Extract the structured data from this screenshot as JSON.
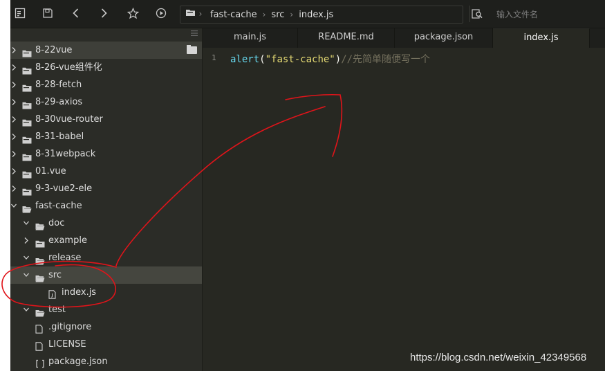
{
  "toolbar": {
    "icons": [
      "sidebar-toggle-icon",
      "save-icon",
      "back-icon",
      "forward-icon",
      "star-icon",
      "play-icon"
    ],
    "path": {
      "segments": [
        "fast-cache",
        "src",
        "index.js"
      ],
      "separator": "›"
    },
    "search": {
      "placeholder": "输入文件名"
    }
  },
  "sidebar": {
    "items": [
      {
        "label": "8-22vue",
        "type": "folder",
        "state": "collapsed"
      },
      {
        "label": "8-26-vue组件化",
        "type": "folder",
        "state": "collapsed"
      },
      {
        "label": "8-28-fetch",
        "type": "folder",
        "state": "collapsed"
      },
      {
        "label": "8-29-axios",
        "type": "folder",
        "state": "collapsed"
      },
      {
        "label": "8-30vue-router",
        "type": "folder",
        "state": "collapsed"
      },
      {
        "label": "8-31-babel",
        "type": "folder",
        "state": "collapsed"
      },
      {
        "label": "8-31webpack",
        "type": "folder",
        "state": "collapsed"
      },
      {
        "label": "01.vue",
        "type": "folder",
        "state": "collapsed"
      },
      {
        "label": "9-3-vue2-ele",
        "type": "folder",
        "state": "collapsed"
      },
      {
        "label": "fast-cache",
        "type": "folder",
        "state": "expanded"
      },
      {
        "label": "doc",
        "type": "folder",
        "state": "expanded"
      },
      {
        "label": "example",
        "type": "folder",
        "state": "collapsed"
      },
      {
        "label": "release",
        "type": "folder",
        "state": "expanded"
      },
      {
        "label": "src",
        "type": "folder",
        "state": "expanded"
      },
      {
        "label": "index.js",
        "type": "js-file",
        "state": "none"
      },
      {
        "label": "test",
        "type": "folder",
        "state": "expanded"
      },
      {
        "label": ".gitignore",
        "type": "file",
        "state": "none"
      },
      {
        "label": "LICENSE",
        "type": "file",
        "state": "none"
      },
      {
        "label": "package.json",
        "type": "json-file",
        "state": "none"
      }
    ]
  },
  "tabs": [
    {
      "label": "main.js"
    },
    {
      "label": "README.md"
    },
    {
      "label": "package.json"
    },
    {
      "label": "index.js",
      "active": true
    }
  ],
  "editor": {
    "line_number": "1",
    "code": {
      "fn": "alert",
      "open": "(",
      "str": "\"fast-cache\"",
      "close": ")",
      "comment": "//先简单随便写一个"
    }
  },
  "watermark": "https://blog.csdn.net/weixin_42349568",
  "colors": {
    "annotation": "#e0141a",
    "editor_bg": "#272822",
    "sidebar_bg": "#2b2c27",
    "selected_row": "#45463f",
    "string": "#e6db74",
    "function": "#66d9ef",
    "comment": "#75715e"
  }
}
